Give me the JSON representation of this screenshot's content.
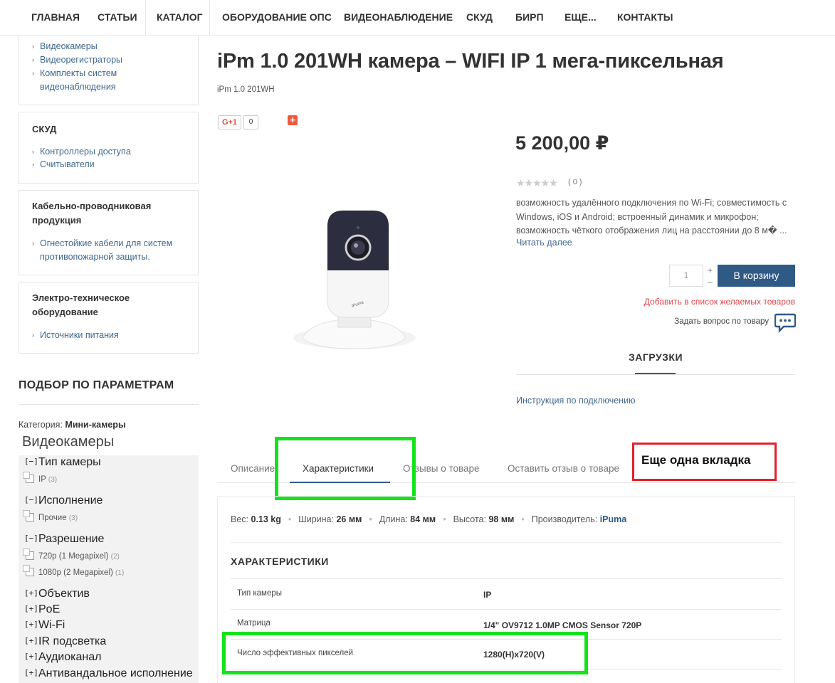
{
  "nav": {
    "items": [
      "ГЛАВНАЯ",
      "СТАТЬИ",
      "КАТАЛОГ",
      "ОБОРУДОВАНИЕ ОПС",
      "ВИДЕОНАБЛЮДЕНИЕ",
      "СКУД",
      "БИРП",
      "ЕЩЕ...",
      "КОНТАКТЫ"
    ]
  },
  "sidebar": {
    "video_links": [
      "Видеокамеры",
      "Видеорегистраторы",
      "Комплекты систем",
      "видеонаблюдения"
    ],
    "skud": {
      "title": "СКУД",
      "links": [
        "Контроллеры доступа",
        "Считыватели"
      ]
    },
    "cable": {
      "title1": "Кабельно-проводниковая",
      "title2": "продукция",
      "link1": "Огнестойкие кабели для систем",
      "link2": "противопожарной защиты."
    },
    "electro": {
      "title1": "Электро-техническое",
      "title2": "оборудование",
      "link": "Источники питания"
    }
  },
  "filter": {
    "title": "ПОДБОР ПО ПАРАМЕТРАМ",
    "category_label": "Категория:",
    "category_value": "Мини-камеры",
    "category_big": "Видеокамеры",
    "groups": [
      {
        "toggle": "[−]",
        "label": "Тип камеры"
      },
      {
        "toggle": "[−]",
        "label": "Исполнение"
      },
      {
        "toggle": "[−]",
        "label": "Разрешение"
      },
      {
        "toggle": "[+]",
        "label": "Объектив"
      },
      {
        "toggle": "[+]",
        "label": "PoE"
      },
      {
        "toggle": "[+]",
        "label": "Wi-Fi"
      },
      {
        "toggle": "[+]",
        "label": "IR подсветка"
      },
      {
        "toggle": "[+]",
        "label": "Аудиоканал"
      },
      {
        "toggle": "[+]",
        "label": "Антивандальное исполнение"
      }
    ],
    "options": [
      {
        "label": "IP",
        "count": "(3)"
      },
      {
        "label": "Прочие",
        "count": "(3)"
      },
      {
        "label": "720p (1 Megapixel)",
        "count": "(2)"
      },
      {
        "label": "1080p (2 Megapixel)",
        "count": "(1)"
      }
    ]
  },
  "product": {
    "title": "iPm 1.0 201WH камера – WIFI IP 1 мега-пиксельная",
    "sku": "iPm 1.0 201WH",
    "gplus_label": "G+1",
    "gplus_count": "0",
    "add_icon": "+",
    "price": "5 200,00 ₽",
    "stars": "★★★★★",
    "rating_count": "( 0 )",
    "desc": "возможность удалённого подключения по Wi-Fi; совместимость с Windows, iOS и Android; встроенный динамик и микрофон; возможность чёткого отображения лиц на расстоянии до 8 м� ...",
    "read_more": "Читать далее",
    "qty": "1",
    "qty_plus": "+",
    "qty_minus": "–",
    "cart_button": "В корзину",
    "wishlist": "Добавить в список желаемых товаров",
    "ask": "Задать вопрос по товару",
    "downloads_title": "ЗАГРУЗКИ",
    "downloads_link": "Инструкция по подключению"
  },
  "tabs": [
    "Описание",
    "Характеристики",
    "Отзывы о товаре",
    "Оставить отзыв о товаре"
  ],
  "annotation_label": "Еще одна вкладка",
  "attrs": {
    "weight_label": "Вес:",
    "weight": "0.13 kg",
    "width_label": "Ширина:",
    "width": "26 мм",
    "length_label": "Длина:",
    "length": "84 мм",
    "height_label": "Высота:",
    "height": "98 мм",
    "mfr_label": "Производитель:",
    "mfr": "iPuma",
    "sep": "•"
  },
  "specs": {
    "title": "ХАРАКТЕРИСТИКИ",
    "rows": [
      {
        "k": "Тип камеры",
        "v": "IP"
      },
      {
        "k": "Матрица",
        "v": "1/4\" OV9712 1.0MP CMOS Sensor 720P"
      },
      {
        "k": "Число эффективных пикселей",
        "v": "1280(H)x720(V)"
      }
    ]
  },
  "colors": {
    "accent": "#2f5a86",
    "link": "#40688e",
    "wish": "#e0434d",
    "highlight_green": "#14e31c",
    "highlight_red": "#e2202b"
  }
}
